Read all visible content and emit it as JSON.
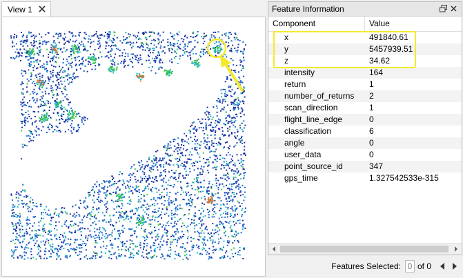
{
  "view": {
    "tab_label": "View 1"
  },
  "feature_info": {
    "title": "Feature Information",
    "columns": {
      "component": "Component",
      "value": "Value"
    },
    "rows": [
      {
        "component": "x",
        "value": "491840.61"
      },
      {
        "component": "y",
        "value": "5457939.51"
      },
      {
        "component": "z",
        "value": "34.62"
      },
      {
        "component": "intensity",
        "value": "164"
      },
      {
        "component": "return",
        "value": "1"
      },
      {
        "component": "number_of_returns",
        "value": "2"
      },
      {
        "component": "scan_direction",
        "value": "1"
      },
      {
        "component": "flight_line_edge",
        "value": "0"
      },
      {
        "component": "classification",
        "value": "6"
      },
      {
        "component": "angle",
        "value": "0"
      },
      {
        "component": "user_data",
        "value": "0"
      },
      {
        "component": "point_source_id",
        "value": "347"
      },
      {
        "component": "gps_time",
        "value": "1.327542533e-315"
      }
    ]
  },
  "footer": {
    "features_selected_label": "Features Selected:",
    "selected_value": "0",
    "of_label": "of 0"
  },
  "colors": {
    "highlight": "#f5ea2a",
    "point_dark_blue": "#1a2fa0",
    "point_blue": "#1e66d0",
    "point_cyan": "#1fb7c9",
    "point_green": "#38c24a",
    "point_orange": "#d9702a"
  }
}
